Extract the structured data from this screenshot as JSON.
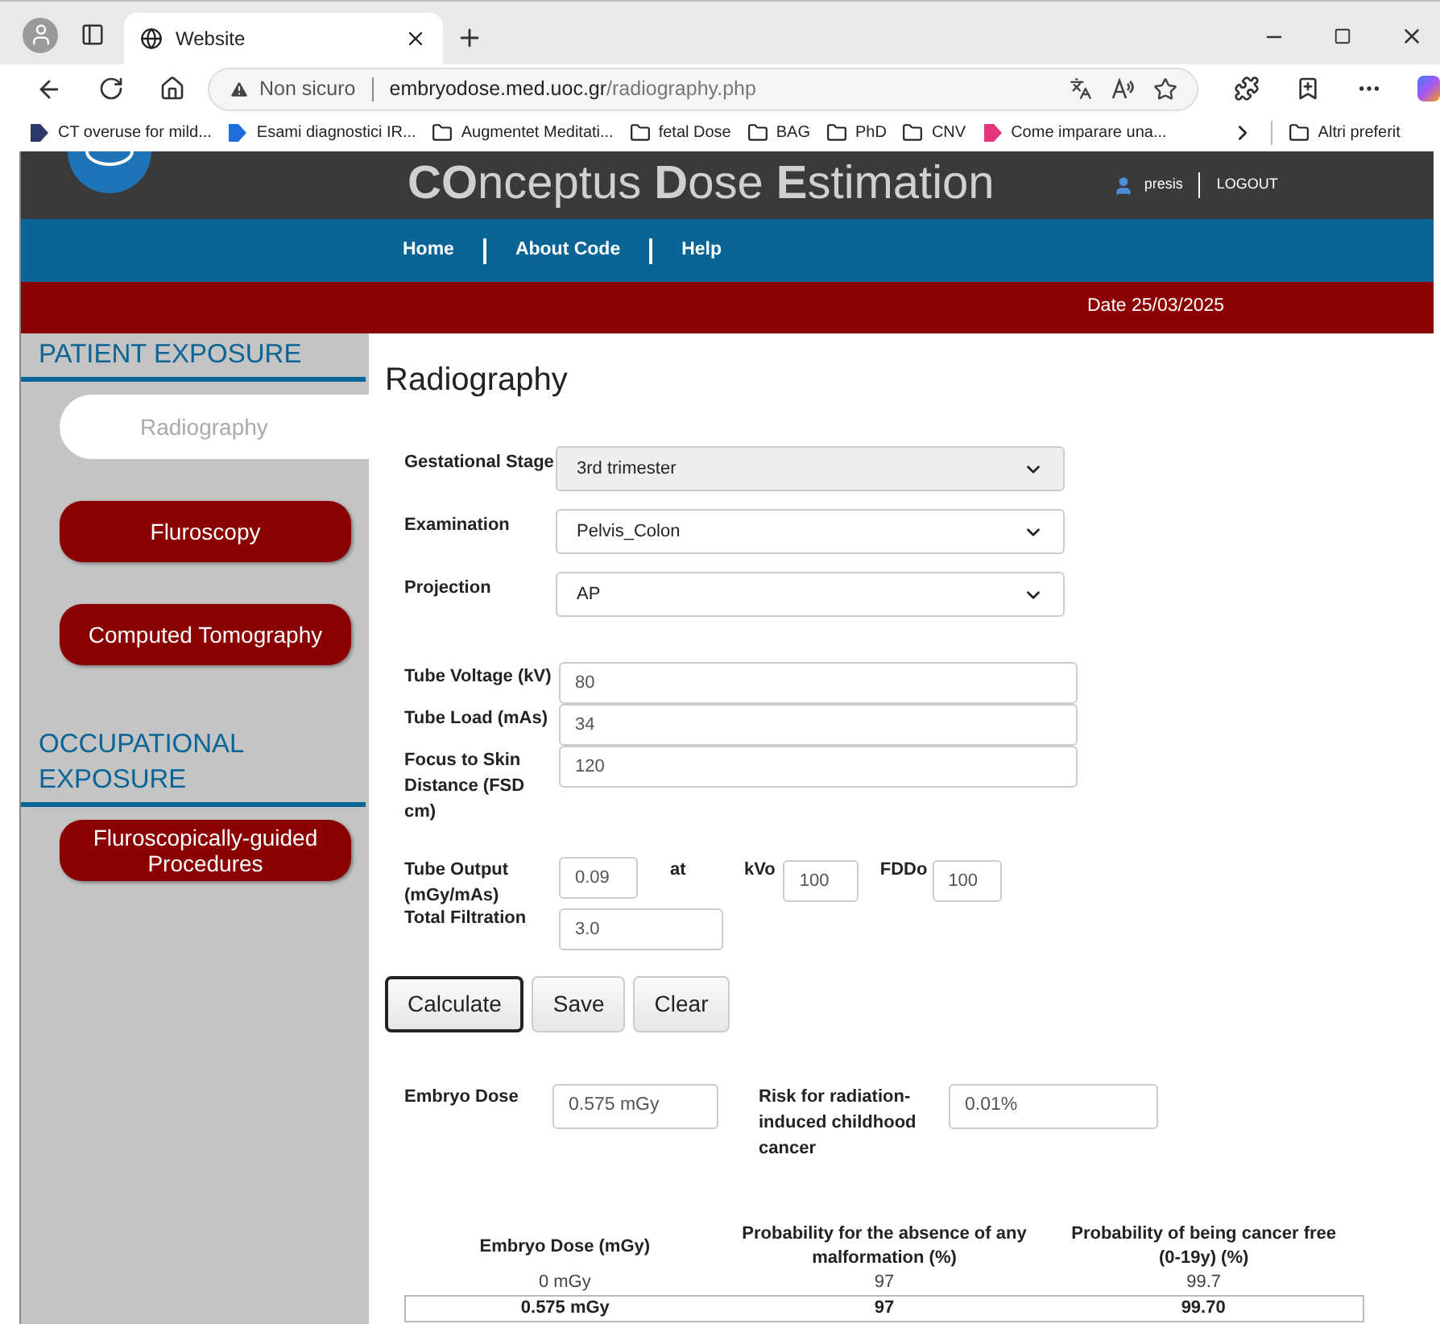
{
  "browser": {
    "tabs": [
      {
        "title": "Website",
        "selected": true
      }
    ],
    "address": {
      "security": "Non sicuro",
      "host": "embryodose.med.uoc.gr",
      "path": "/radiography.php"
    },
    "bookmarks": [
      {
        "kind": "site",
        "label": "CT overuse for mild...",
        "color": "#2b3a67"
      },
      {
        "kind": "site",
        "label": "Esami diagnostici IR...",
        "color": "#1e6fd9"
      },
      {
        "kind": "folder",
        "label": "Augmentet Meditati..."
      },
      {
        "kind": "folder",
        "label": "fetal Dose"
      },
      {
        "kind": "folder",
        "label": "BAG"
      },
      {
        "kind": "folder",
        "label": "PhD"
      },
      {
        "kind": "folder",
        "label": "CNV"
      },
      {
        "kind": "site",
        "label": "Come imparare una...",
        "color": "#e6347a"
      }
    ],
    "other_bookmarks": "Altri preferit"
  },
  "header": {
    "title": "**CO**nceptus **D**ose **E**stimation",
    "user": "presis",
    "logout": "LOGOUT"
  },
  "nav": [
    "Home",
    "About Code",
    "Help"
  ],
  "date": "Date 25/03/2025",
  "sidebar": [
    {
      "title": "PATIENT EXPOSURE",
      "items": [
        {
          "label": "Radiography",
          "selected": true
        },
        {
          "label": "Fluroscopy",
          "selected": false
        },
        {
          "label": "Computed Tomography",
          "selected": false
        }
      ]
    },
    {
      "title": "OCCUPATIONAL EXPOSURE",
      "items": [
        {
          "label": "Fluroscopically-guided Procedures",
          "selected": false
        }
      ]
    }
  ],
  "heading": "Radiography",
  "selects": [
    {
      "label": "Gestational Stage",
      "value": "3rd trimester",
      "disabled": true
    },
    {
      "label": "Examination",
      "value": "Pelvis_Colon",
      "disabled": false
    },
    {
      "label": "Projection",
      "value": "AP",
      "disabled": false
    }
  ],
  "inputs": [
    {
      "label": "Tube Voltage (kV)",
      "value": "80"
    },
    {
      "label": "Tube Load (mAs)",
      "value": "34"
    },
    {
      "label": "Focus to Skin Distance (FSD cm)",
      "value": "120"
    }
  ],
  "tube_output": {
    "label": "Tube Output (mGy/mAs)",
    "value": "0.09",
    "at": "at",
    "kvo_label": "kVo",
    "kvo": "100",
    "fddo_label": "FDDo",
    "fddo": "100"
  },
  "filtration": {
    "label": "Total Filtration",
    "value": "3.0"
  },
  "buttons": [
    {
      "label": "Calculate",
      "focused": true
    },
    {
      "label": "Save",
      "focused": false
    },
    {
      "label": "Clear",
      "focused": false
    }
  ],
  "results": [
    {
      "label": "Embryo Dose",
      "value": "0.575 mGy"
    },
    {
      "label": "Risk for radiation-induced childhood cancer",
      "value": "0.01%"
    }
  ],
  "table": {
    "columns": [
      "Embryo Dose (mGy)",
      "Probability for the absence of any malformation (%)",
      "Probability of being cancer free (0-19y) (%)"
    ],
    "rows": [
      {
        "cells": [
          "0 mGy",
          "97",
          "99.7"
        ],
        "highlighted": false
      },
      {
        "cells": [
          "0.575 mGy",
          "97",
          "99.70"
        ],
        "highlighted": true
      }
    ]
  }
}
